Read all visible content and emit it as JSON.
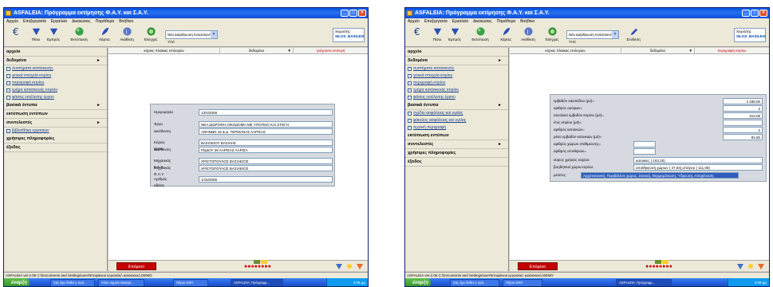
{
  "left": {
    "window": {
      "title": "ASFALEIA: Πρόγραμμα εκτίμησης Φ.Α.Υ. και Σ.Α.Υ."
    },
    "menu": [
      "Αρχείο",
      "Επεξεργασία",
      "Εργαλεία",
      "Δικαιώσεις",
      "Παράθυρα",
      "Βοήθεια"
    ],
    "toolbar": {
      "btn_prev": "Πίσω",
      "btn_next": "Εμπρός",
      "btn_print": "Εκτύπωση",
      "btn_help": "Χάρτες",
      "btn_info": "Ανάθεση",
      "btn_check": "Έλεγχος",
      "combo": "Νέα Διάρθρωση Κατασκευής Υπό",
      "user_label": "Χειριστής",
      "user_name": "SILOS_BASILEIS"
    },
    "sidebar": {
      "sections": [
        {
          "label": "αρχείο",
          "arrow": ""
        },
        {
          "label": "δεδομένα",
          "arrow": "►"
        }
      ],
      "items": [
        "συστήματα κατασκευής",
        "γενικά στοιχεία κτιρίου",
        "περιγραφή κτιρίου",
        "τμήμα κατασκευής κτιρίου",
        "φάσεις εκτέλεσης έργου"
      ],
      "sections2": [
        {
          "label": "βασικά έντυπα",
          "arrow": "►"
        },
        {
          "label": "εκτύπωση εντύπων",
          "arrow": ""
        },
        {
          "label": "συντελεστές",
          "arrow": "►"
        }
      ],
      "items2": [
        "βιβλιοθήκη εργασιών"
      ],
      "sections3": [
        {
          "label": "χρήσιμες πληροφορίες",
          "arrow": ""
        },
        {
          "label": "έξοδος",
          "arrow": ""
        }
      ]
    },
    "tabs": [
      "κύριος πίνακας επιλογών",
      "δεδομένα",
      "τρέχουσα επιλογή"
    ],
    "fields": [
      {
        "label": "Ημερομηνία",
        "value": "13/4/2008"
      },
      {
        "label": "Έργο",
        "value": "ΝΕΑ ΔΙΩΡΟΦΗ ΟΙΚΟΔΟΜΗ ΜΕ ΥΠΟΓΕΙΟ ΚΑΙ ΣΤΕΓΗ"
      },
      {
        "label": "Διεύθυνση",
        "value": "ΑΘΗΝΩΝ 15 & Δ. ΤΕΡΜΑΝΑΣ ΛΑΡΙΣΑΣ"
      },
      {
        "label": "Κύριος έργου",
        "value": "ΒΑΣΙΛΕΙΟΥ ΒΑΣΙΛΗΣ"
      },
      {
        "label": "Διεύθυνση",
        "value": "ΡΩΔΟΥ 25 ΛΑΡΙΣΑΣ ΛΑΡΙΣΑ"
      },
      {
        "label": "Μηχανικός Σ.Α.Υ.",
        "value": "ΧΡΙΣΤΟΠΟΥΛΟΣ ΒΑΣΙΛΕΙΟΣ"
      },
      {
        "label": "Μηχανικός Φ.Α.Υ.",
        "value": "ΧΡΙΣΤΟΠΟΥΛΟΣ ΒΑΣΙΛΕΙΟΣ"
      },
      {
        "label": "Αριθμός αδείας",
        "value": "1/15/2008"
      }
    ],
    "bottom": {
      "red_button": "Επόμενο",
      "counter": "●●●●●●●●"
    },
    "status": "ASFALEIA ver.2.05   C:\\Documents and Settings\\user\\Επιφάνεια εργασίας\\ κατασκευή DEMO",
    "taskbar": {
      "start": "έναρξη",
      "tasks": [
        "Σας έχει δοθεί η πρό...",
        "Άλλο σημείο κλικαρί...",
        "Πόροι 2007",
        "ASFALEIA: Πρόγραμμ..."
      ],
      "clock": "3:05 μμ"
    }
  },
  "right": {
    "window": {
      "title": "ASFALEIA: Πρόγραμμα εκτίμησης Φ.Α.Υ. και Σ.Α.Υ."
    },
    "menu": [
      "Αρχείο",
      "Επεξεργασία",
      "Εργαλεία",
      "Δικαιώσεις",
      "Παράθυρα",
      "Βοήθεια"
    ],
    "toolbar": {
      "btn_prev": "Πίσω",
      "btn_next": "Εμπρός",
      "btn_print": "Εκτύπωση",
      "btn_help": "Χάρτες",
      "btn_info": "Ανάθεση",
      "btn_check": "Έλεγχος",
      "combo": "Νέα Διάρθρωση Κατασκευής Υπό",
      "conn": "Σύνδεση",
      "user_label": "Χειριστής",
      "user_name": "SILOS_BASILEIS"
    },
    "sidebar": {
      "sections": [
        {
          "label": "αρχείο",
          "arrow": ""
        },
        {
          "label": "δεδομένα",
          "arrow": "►"
        }
      ],
      "items": [
        "συστήματα κατασκευής",
        "γενικά στοιχεία κτιρίου",
        "περιγραφή κτιρίου",
        "τμήμα κατασκευής κτιρίου",
        "φάσεις εκτέλεσης έργου"
      ],
      "sections2": [
        {
          "label": "βασικά έντυπα",
          "arrow": "►"
        }
      ],
      "items2": [
        "σχέδιο ασφάλειας και υγείας",
        "φάκελος ασφάλειας και υγείας",
        "τεχνική περιγραφή"
      ],
      "sections3": [
        {
          "label": "εκτύπωση εντύπων",
          "arrow": ""
        },
        {
          "label": "συντελεστές",
          "arrow": "►"
        },
        {
          "label": "χρήσιμες πληροφορίες",
          "arrow": ""
        },
        {
          "label": "έξοδος",
          "arrow": ""
        }
      ]
    },
    "tabs": [
      "κύριος πίνακας επιλογών",
      "δεδομένα",
      "περιγραφή κτιρίου"
    ],
    "fields": [
      {
        "label": "εμβαδόν οικοπέδου (μ2)=",
        "value": "4 336,00",
        "num": true
      },
      {
        "label": "αριθμός ορόφων=",
        "value": "2",
        "num": true
      },
      {
        "label": "συνολικό εμβαδόν κτιρίου (μ2)=",
        "value": "312,05",
        "num": true
      },
      {
        "label": "έτος κτιρίου (μ3)=",
        "value": "",
        "num": true
      },
      {
        "label": "αριθμός κατοικιών=",
        "value": "2",
        "num": true
      },
      {
        "label": "μέσο εμβαδόν κατοικιών (μ2)=",
        "value": "81,60",
        "num": true
      },
      {
        "label": "αριθμός χώρων στάθμευσης=",
        "value": "",
        "num": true
      },
      {
        "label": "αριθμός αποθηκών=",
        "value": "",
        "num": true
      },
      {
        "label": "κύριος χρήσεις κτιρίου:",
        "value": "κατοικίες ( 163,25)",
        "num": false
      },
      {
        "label": "βοηθητικοί χώροι κτιρίου:",
        "value": "αποθήκευση χώρων ( 37,64),υπόγειο ( 111,06)",
        "num": false
      },
      {
        "label": "μελέτες:",
        "value": "Αρχιτεκτονική, Περιβάλλον χώρος, Στατική, Θερμομόνωση, Ύδρευση, Αποχέτευση",
        "num": false,
        "hl": true
      }
    ],
    "bottom": {
      "red_button": "Επόμενο",
      "counter": "●●●●●●●●"
    },
    "status": "ASFALEIA ver.2.05   C:\\Documents and Settings\\user\\Επιφάνεια εργασίας\\ κατασκευή DEMO",
    "taskbar": {
      "start": "έναρξη",
      "tasks": [
        "Σας έχει δοθεί η πρό...",
        "Πόροι 2007",
        "ASFALEIA: Πρόγραμμ..."
      ],
      "clock": "3:09 μμ"
    }
  },
  "colors": {
    "title_blue": "#0054e3",
    "red_button": "#c40000",
    "highlight": "#2f5dbd",
    "panel": "#d6dae0"
  }
}
